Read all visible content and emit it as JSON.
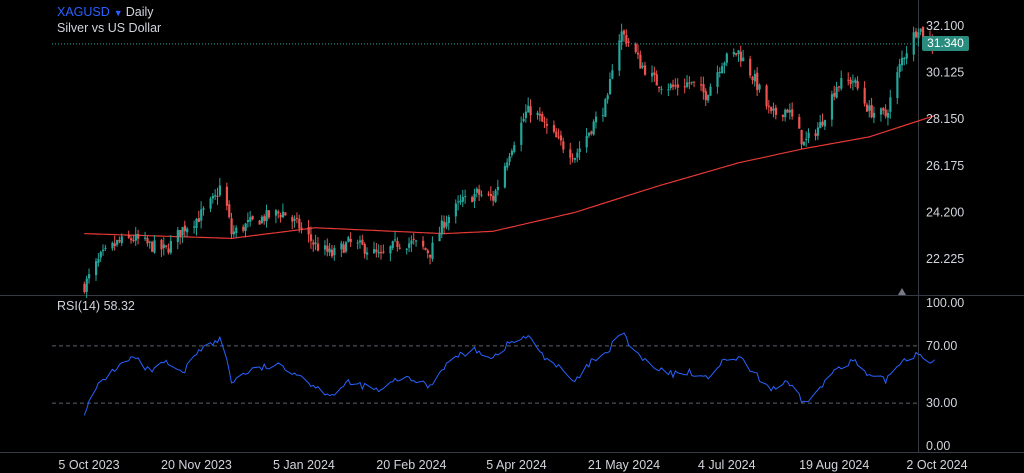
{
  "header": {
    "symbol": "XAGUSD",
    "timeframe": "Daily",
    "description": "Silver vs US Dollar"
  },
  "price_badge": "31.340",
  "rsi": {
    "label": "RSI(14)",
    "value": "58.32"
  },
  "colors": {
    "background": "#000000",
    "up": "#26a69a",
    "down": "#ef5350",
    "ma": "#e53935",
    "rsi": "#2962ff",
    "symbol": "#2962ff",
    "price_line": "#26a69a"
  },
  "chart_data": [
    {
      "type": "candlestick",
      "y_ticks": [
        "32.100",
        "30.125",
        "28.150",
        "26.175",
        "24.200",
        "22.225"
      ],
      "ylim": [
        20.7,
        33.2
      ],
      "x_ticks": [
        "5 Oct 2023",
        "20 Nov 2023",
        "5 Jan 2024",
        "20 Feb 2024",
        "5 Apr 2024",
        "21 May 2024",
        "4 Jul 2024",
        "19 Aug 2024",
        "2 Oct 2024"
      ],
      "x_tick_dates": [
        "2023-10-05",
        "2023-11-20",
        "2024-01-05",
        "2024-02-20",
        "2024-04-05",
        "2024-05-21",
        "2024-07-04",
        "2024-08-19",
        "2024-10-02"
      ],
      "last_price": 31.34,
      "close_series": {
        "dates": [
          "2023-10-03",
          "2023-10-10",
          "2023-10-17",
          "2023-10-24",
          "2023-10-31",
          "2023-11-07",
          "2023-11-14",
          "2023-11-21",
          "2023-11-28",
          "2023-12-01",
          "2023-12-05",
          "2023-12-12",
          "2023-12-19",
          "2023-12-27",
          "2024-01-03",
          "2024-01-10",
          "2024-01-17",
          "2024-01-24",
          "2024-01-31",
          "2024-02-07",
          "2024-02-14",
          "2024-02-21",
          "2024-02-28",
          "2024-03-05",
          "2024-03-12",
          "2024-03-19",
          "2024-03-26",
          "2024-04-02",
          "2024-04-09",
          "2024-04-12",
          "2024-04-16",
          "2024-04-23",
          "2024-04-30",
          "2024-05-07",
          "2024-05-14",
          "2024-05-17",
          "2024-05-20",
          "2024-05-24",
          "2024-05-28",
          "2024-06-04",
          "2024-06-11",
          "2024-06-18",
          "2024-06-25",
          "2024-07-02",
          "2024-07-09",
          "2024-07-16",
          "2024-07-23",
          "2024-07-30",
          "2024-08-06",
          "2024-08-13",
          "2024-08-20",
          "2024-08-27",
          "2024-09-03",
          "2024-09-10",
          "2024-09-17",
          "2024-09-24",
          "2024-09-27",
          "2024-10-01"
        ],
        "values": [
          21.1,
          22.3,
          22.9,
          23.1,
          22.8,
          22.6,
          23.5,
          24.0,
          24.8,
          25.5,
          23.3,
          23.7,
          24.0,
          24.2,
          23.6,
          22.8,
          22.4,
          22.9,
          22.7,
          22.3,
          22.9,
          22.9,
          22.5,
          23.8,
          24.6,
          25.0,
          24.8,
          26.8,
          28.4,
          28.6,
          28.0,
          27.2,
          26.6,
          27.8,
          28.9,
          31.2,
          31.8,
          31.3,
          30.5,
          29.7,
          29.5,
          29.7,
          29.2,
          30.6,
          31.0,
          29.8,
          28.3,
          28.6,
          27.1,
          27.9,
          29.6,
          29.8,
          28.5,
          28.3,
          30.7,
          32.1,
          31.6,
          31.34
        ]
      },
      "moving_average": {
        "dates": [
          "2023-10-03",
          "2023-12-05",
          "2024-01-10",
          "2024-03-05",
          "2024-03-26",
          "2024-04-30",
          "2024-06-04",
          "2024-07-09",
          "2024-08-06",
          "2024-09-03",
          "2024-10-01"
        ],
        "values": [
          23.3,
          23.1,
          23.55,
          23.3,
          23.4,
          24.2,
          25.3,
          26.3,
          26.9,
          27.4,
          28.3
        ]
      }
    },
    {
      "type": "line",
      "series": [
        {
          "name": "RSI(14)",
          "x": [
            "2023-10-03",
            "2023-10-10",
            "2023-10-17",
            "2023-10-24",
            "2023-10-31",
            "2023-11-07",
            "2023-11-14",
            "2023-11-21",
            "2023-11-28",
            "2023-12-01",
            "2023-12-05",
            "2023-12-12",
            "2023-12-19",
            "2023-12-27",
            "2024-01-03",
            "2024-01-10",
            "2024-01-17",
            "2024-01-24",
            "2024-01-31",
            "2024-02-07",
            "2024-02-14",
            "2024-02-21",
            "2024-02-28",
            "2024-03-05",
            "2024-03-12",
            "2024-03-19",
            "2024-03-26",
            "2024-04-02",
            "2024-04-09",
            "2024-04-12",
            "2024-04-16",
            "2024-04-23",
            "2024-04-30",
            "2024-05-07",
            "2024-05-14",
            "2024-05-17",
            "2024-05-20",
            "2024-05-24",
            "2024-05-28",
            "2024-06-04",
            "2024-06-11",
            "2024-06-18",
            "2024-06-25",
            "2024-07-02",
            "2024-07-09",
            "2024-07-16",
            "2024-07-23",
            "2024-07-30",
            "2024-08-06",
            "2024-08-13",
            "2024-08-20",
            "2024-08-27",
            "2024-09-03",
            "2024-09-10",
            "2024-09-17",
            "2024-09-24",
            "2024-09-27",
            "2024-10-01"
          ],
          "values": [
            24,
            45,
            55,
            62,
            52,
            58,
            50,
            68,
            72,
            76,
            45,
            52,
            55,
            56,
            50,
            41,
            36,
            44,
            42,
            38,
            47,
            46,
            42,
            56,
            64,
            67,
            62,
            72,
            76,
            74,
            64,
            55,
            44,
            59,
            64,
            76,
            79,
            70,
            62,
            53,
            50,
            52,
            47,
            58,
            62,
            50,
            40,
            44,
            30,
            40,
            55,
            60,
            48,
            46,
            60,
            65,
            62,
            58.32
          ]
        }
      ],
      "y_ticks": [
        "100.00",
        "70.00",
        "30.00",
        "0.00"
      ],
      "ylim": [
        0,
        100
      ],
      "bands": [
        30,
        70
      ]
    }
  ]
}
